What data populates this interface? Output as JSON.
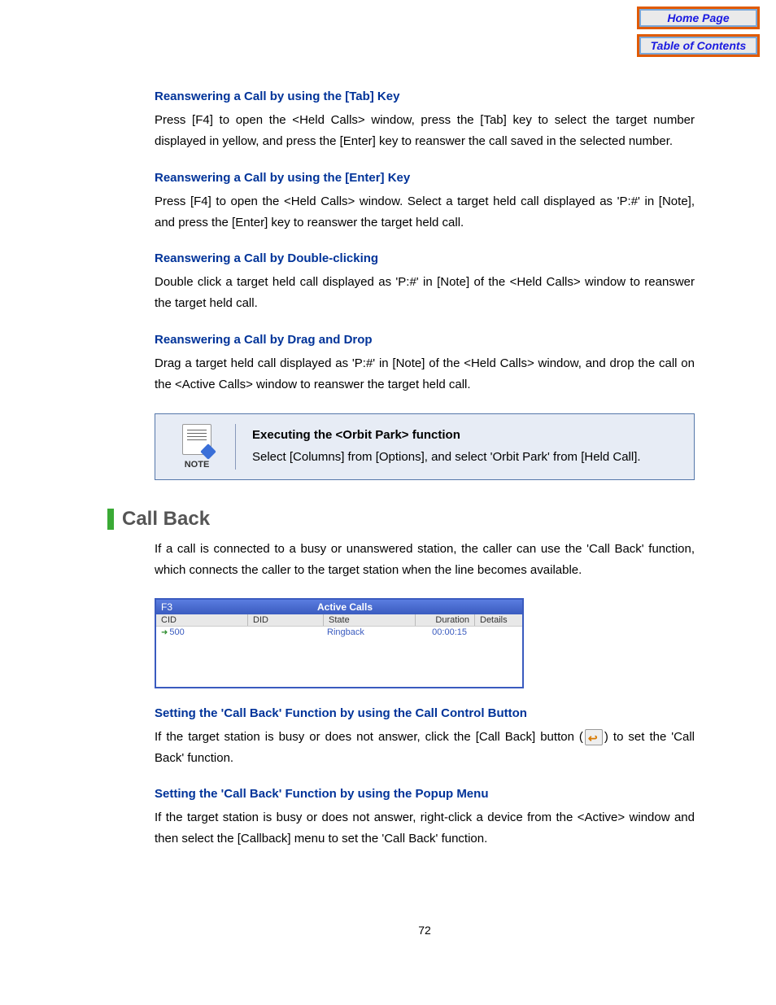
{
  "nav": {
    "home": "Home Page",
    "toc": "Table of Contents"
  },
  "sections": {
    "tab": {
      "heading": "Reanswering a Call by using the [Tab] Key",
      "body": "Press [F4] to open the <Held Calls> window, press the [Tab] key to select the target number displayed in yellow, and press the [Enter] key to reanswer the call saved in the selected number."
    },
    "enter": {
      "heading": "Reanswering a Call by using the [Enter] Key",
      "body": "Press [F4] to open the <Held Calls> window. Select a target held call displayed as 'P:#' in [Note], and press the [Enter] key to reanswer the target held call."
    },
    "double": {
      "heading": "Reanswering a Call by Double-clicking",
      "body": "Double click a target held call displayed as 'P:#' in [Note] of the <Held Calls> window to reanswer the target held call."
    },
    "drag": {
      "heading": "Reanswering a Call by Drag and Drop",
      "body": "Drag a target held call displayed as 'P:#' in [Note] of the <Held Calls> window, and drop the call on the <Active Calls> window to reanswer the target held call."
    },
    "callback_button": {
      "heading": "Setting the 'Call Back' Function by using the Call Control Button",
      "body_pre": "If the target station is busy or does not answer, click the [Call Back] button (",
      "body_post": ") to set the 'Call Back' function."
    },
    "callback_popup": {
      "heading": "Setting the 'Call Back' Function by using the Popup Menu",
      "body": "If the target station is busy or does not answer, right-click a device from the <Active> window and then select the [Callback] menu to set the 'Call Back' function."
    }
  },
  "note": {
    "label": "NOTE",
    "title": "Executing the <Orbit Park> function",
    "body": "Select [Columns] from [Options], and select 'Orbit Park' from [Held Call]."
  },
  "callback": {
    "title": "Call Back",
    "intro": "If a call is connected to a busy or unanswered station, the caller can use the 'Call Back' function, which connects the caller to the target station when the line becomes available."
  },
  "window": {
    "shortcut": "F3",
    "title": "Active Calls",
    "headers": {
      "cid": "CID",
      "did": "DID",
      "state": "State",
      "duration": "Duration",
      "details": "Details"
    },
    "row": {
      "cid": "500",
      "did": "",
      "state": "Ringback",
      "duration": "00:00:15",
      "details": ""
    }
  },
  "page_number": "72"
}
